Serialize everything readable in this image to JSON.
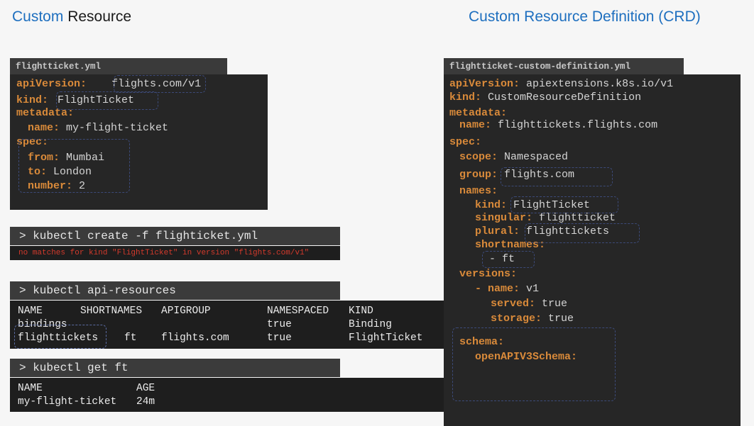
{
  "titles": {
    "left_blue": "Custom",
    "left_dark": "Resource",
    "right": "Custom Resource Definition (CRD)"
  },
  "left_file": {
    "tab": "flightticket.yml",
    "lines": [
      {
        "key": "apiVersion:",
        "val": "flights.com/v1"
      },
      {
        "key": "kind:",
        "val": "FlightTicket"
      },
      {
        "key": "metadata:",
        "val": ""
      },
      {
        "key": "name:",
        "val": "my-flight-ticket"
      },
      {
        "key": "spec:",
        "val": ""
      },
      {
        "key": "from:",
        "val": "Mumbai"
      },
      {
        "key": "to:",
        "val": "London"
      },
      {
        "key": "number:",
        "val": "2"
      }
    ]
  },
  "cmd_create": {
    "command": "> kubectl create -f flighticket.yml",
    "error": "no matches for kind \"FlightTicket\" in version \"flights.com/v1\""
  },
  "cmd_api": {
    "command": "> kubectl api-resources",
    "headers": [
      "NAME",
      "SHORTNAMES",
      "APIGROUP",
      "NAMESPACED",
      "KIND"
    ],
    "rows": [
      [
        "bindings",
        "",
        "",
        "true",
        "Binding"
      ],
      [
        "flighttickets",
        "ft",
        "flights.com",
        "true",
        "FlightTicket"
      ]
    ]
  },
  "cmd_get": {
    "command": "> kubectl get ft",
    "headers": [
      "NAME",
      "AGE"
    ],
    "rows": [
      [
        "my-flight-ticket",
        "24m"
      ]
    ]
  },
  "right_file": {
    "tab": "flightticket-custom-definition.yml",
    "lines": [
      {
        "key": "apiVersion:",
        "val": "apiextensions.k8s.io/v1"
      },
      {
        "key": "kind:",
        "val": "CustomResourceDefinition"
      },
      {
        "key": "metadata:",
        "val": ""
      },
      {
        "key": "name:",
        "val": "flighttickets.flights.com"
      },
      {
        "key": "spec:",
        "val": ""
      },
      {
        "key": "scope:",
        "val": "Namespaced"
      },
      {
        "key": "group:",
        "val": "flights.com"
      },
      {
        "key": "names:",
        "val": ""
      },
      {
        "key": "kind:",
        "val": "FlightTicket"
      },
      {
        "key": "singular:",
        "val": "flightticket"
      },
      {
        "key": "plural:",
        "val": "flighttickets"
      },
      {
        "key": "shortnames:",
        "val": ""
      },
      {
        "key": "-",
        "val": "ft"
      },
      {
        "key": "versions:",
        "val": ""
      },
      {
        "key": "- name:",
        "val": "v1"
      },
      {
        "key": "served:",
        "val": "true"
      },
      {
        "key": "storage:",
        "val": "true"
      },
      {
        "key": "schema:",
        "val": ""
      },
      {
        "key": "openAPIV3Schema:",
        "val": ""
      }
    ]
  },
  "colors": {
    "title_blue": "#1e6fbf",
    "yaml_key": "#d98a3a",
    "error_red": "#d33a2c",
    "panel_bg": "#262626"
  }
}
